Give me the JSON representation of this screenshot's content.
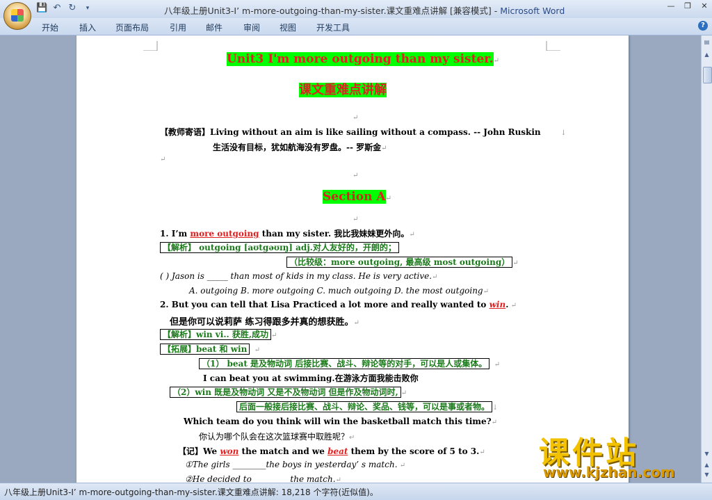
{
  "window": {
    "title": "八年级上册Unit3-I’ m-more-outgoing-than-my-sister.课文重难点讲解 [兼容模式] - ",
    "app": "Microsoft Word"
  },
  "ribbon_tabs": [
    "开始",
    "插入",
    "页面布局",
    "引用",
    "邮件",
    "审阅",
    "视图",
    "开发工具"
  ],
  "doc": {
    "title1": "Unit3 I'm more outgoing than my sister.",
    "title2": "课文重难点讲解",
    "motto_en": "【教师寄语】Living without an aim is like sailing without a compass. -- John Ruskin",
    "motto_cn": "生活没有目标，犹如航海没有罗盘。-- 罗斯金",
    "section": "Section A",
    "s1_prefix": "1. I’m ",
    "s1_key": "more outgoing",
    "s1_suffix": " than my sister.  我比我妹妹更外向。",
    "jiexi1": "【解析】 outgoing [aʊtgəʊɪŋ]    adj.对人友好的，开朗的；",
    "compare": "（比较级：more outgoing, 最高级  most outgoing）",
    "q1": "(       ) Jason is _____ than most of kids in my class.  He is very active.",
    "q1_opts": "A. outgoing      B. more outgoing       C. much outgoing D. the most outgoing",
    "s2_prefix": "2. But you can tell that Lisa Practiced a lot more and really wanted to ",
    "s2_key": "win",
    "s2_suffix": ".",
    "s2_cn": "但是你可以说莉萨 练习得跟多并真的想获胜。",
    "jiexi2": "【解析】win vi.. 获胜,成功",
    "tuozhan": "【拓展】beat 和  win",
    "beat_note": "（1）  beat  是及物动词   后接比赛、战斗、辩论等的对手，可以是人或集体。",
    "beat_ex": "I can beat you at swimming.在游泳方面我能击败你",
    "win_note1": "（2）win 既是及物动词    又是不及物动词   但是作及物动词时,",
    "win_note2": "后面一般接后接比赛、战斗、辩论、奖品、钱等，可以是事或者物。",
    "q2": "Which team do you think will win the basketball match this time?",
    "q2_cn": "你认为哪个队会在这次篮球赛中取胜呢？",
    "ji_prefix": "【记】We ",
    "ji_won": "won",
    "ji_mid": " the match and we ",
    "ji_beat": "beat",
    "ji_suffix": " them by the score of 5 to 3.",
    "ex1": "①The girls ________the boys  in yesterday’ s  match.",
    "ex2": "②He decided to ________ the match."
  },
  "status": "八年级上册Unit3-I’ m-more-outgoing-than-my-sister.课文重难点讲解: 18,218 个字符(近似值)。",
  "watermark": {
    "main": "课件站",
    "url": "www.kjzhan.com"
  }
}
